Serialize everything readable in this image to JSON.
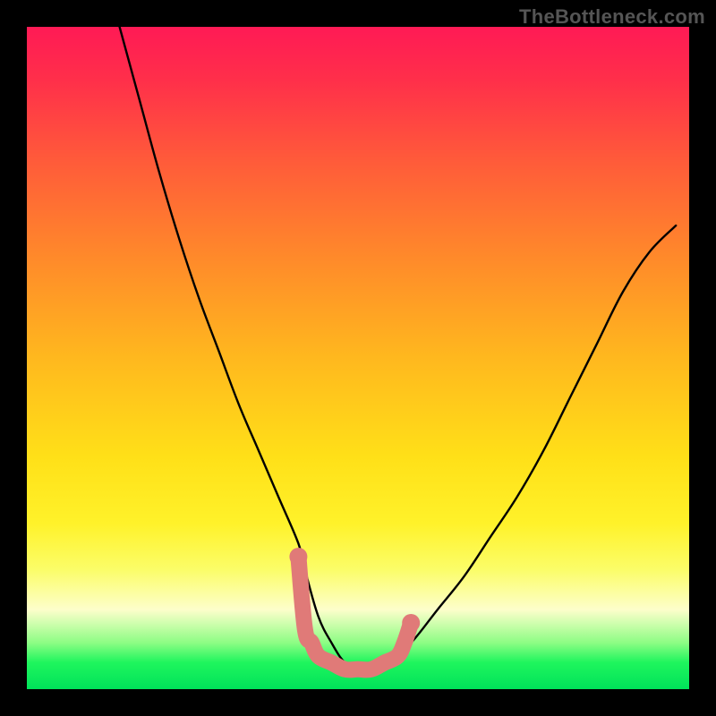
{
  "watermark": "TheBottleneck.com",
  "chart_data": {
    "type": "line",
    "title": "",
    "xlabel": "",
    "ylabel": "",
    "xlim": [
      0,
      100
    ],
    "ylim": [
      0,
      100
    ],
    "grid": false,
    "series": [
      {
        "name": "bottleneck-curve",
        "color": "#000000",
        "x": [
          14,
          17,
          20,
          23,
          26,
          29,
          32,
          35,
          38,
          41,
          42,
          44,
          46,
          48,
          50,
          52,
          54,
          56,
          58,
          62,
          66,
          70,
          74,
          78,
          82,
          86,
          90,
          94,
          98
        ],
        "y": [
          100,
          89,
          78,
          68,
          59,
          51,
          43,
          36,
          29,
          22,
          18,
          11,
          7,
          4,
          3,
          3,
          4,
          6,
          7,
          12,
          17,
          23,
          29,
          36,
          44,
          52,
          60,
          66,
          70
        ]
      },
      {
        "name": "highlight-band",
        "color": "#e07a78",
        "x": [
          41,
          42,
          43,
          44,
          46,
          48,
          50,
          52,
          54,
          56,
          57,
          58
        ],
        "y": [
          20,
          9,
          7,
          5,
          4,
          3,
          3,
          3,
          4,
          5,
          7,
          10
        ]
      }
    ],
    "annotations": []
  },
  "colors": {
    "frame": "#000000",
    "curve": "#000000",
    "highlight": "#e07a78",
    "watermark": "#555555"
  }
}
